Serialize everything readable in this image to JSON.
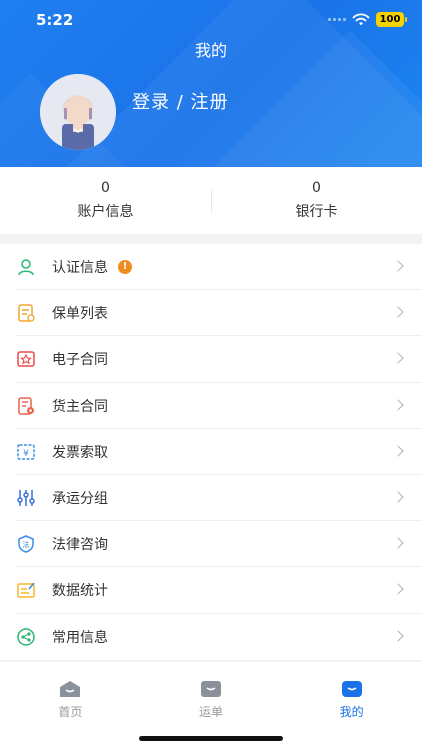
{
  "status_bar": {
    "time": "5:22",
    "battery": "100"
  },
  "header": {
    "title": "我的",
    "login_text": "登录 / 注册"
  },
  "stats": [
    {
      "value": "0",
      "label": "账户信息"
    },
    {
      "value": "0",
      "label": "银行卡"
    }
  ],
  "menu": {
    "items": [
      {
        "label": "认证信息",
        "icon": "user-verify-icon",
        "badge": "!"
      },
      {
        "label": "保单列表",
        "icon": "policy-list-icon"
      },
      {
        "label": "电子合同",
        "icon": "e-contract-icon"
      },
      {
        "label": "货主合同",
        "icon": "shipper-contract-icon"
      },
      {
        "label": "发票索取",
        "icon": "invoice-icon"
      },
      {
        "label": "承运分组",
        "icon": "carrier-group-icon"
      },
      {
        "label": "法律咨询",
        "icon": "legal-consult-icon"
      },
      {
        "label": "数据统计",
        "icon": "data-stats-icon"
      },
      {
        "label": "常用信息",
        "icon": "common-info-icon"
      }
    ]
  },
  "tabbar": {
    "tabs": [
      {
        "label": "首页",
        "icon": "home-icon"
      },
      {
        "label": "运单",
        "icon": "waybill-icon"
      },
      {
        "label": "我的",
        "icon": "mine-icon"
      }
    ],
    "active_index": 2
  },
  "colors": {
    "accent": "#1a73e8",
    "badge": "#f08c1e",
    "battery": "#f5d300"
  }
}
